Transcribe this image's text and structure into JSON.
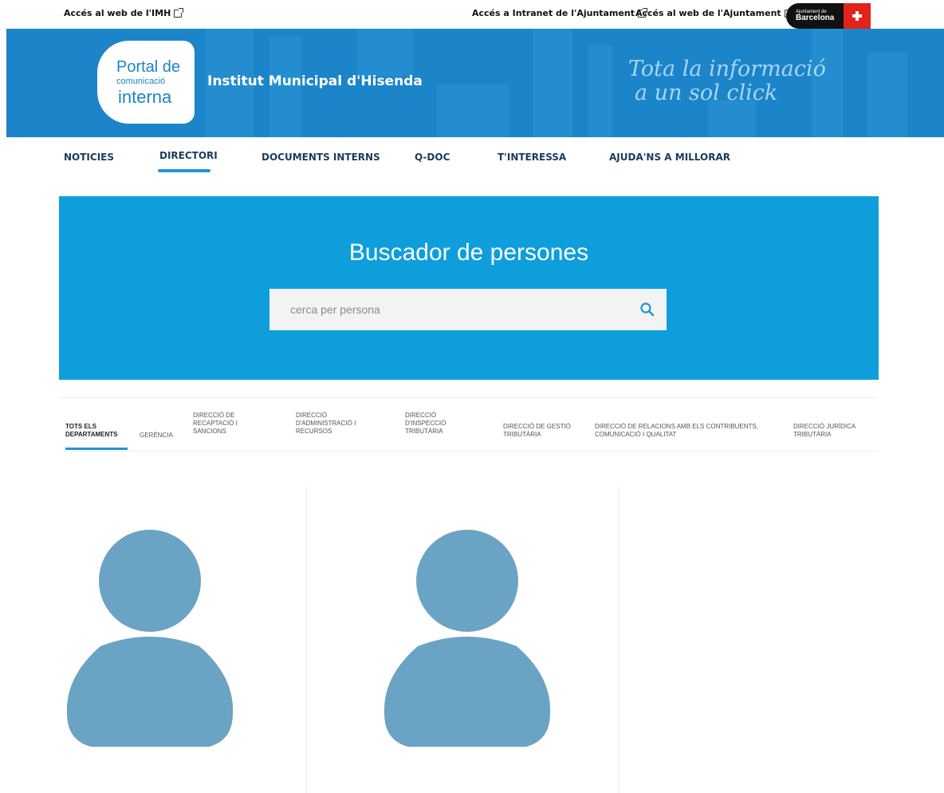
{
  "topbar": {
    "imh_link": "Accés al web de l'IMH",
    "intranet_link": "Accés a Intranet de l'Ajuntament",
    "ajuntament_link": "Accés al web de l'Ajuntament",
    "badge_small": "Ajuntament de",
    "badge_big": "Barcelona"
  },
  "header": {
    "logo_line1": "Portal de",
    "logo_line2": "comunicació",
    "logo_line3": "interna",
    "site_title": "Institut Municipal d'Hisenda",
    "tagline_line1": "Tota la informació",
    "tagline_line2": "a un sol click"
  },
  "nav": {
    "items": [
      {
        "label": "NOTICIES"
      },
      {
        "label": "DIRECTORI"
      },
      {
        "label": "DOCUMENTS INTERNS"
      },
      {
        "label": "Q-DOC"
      },
      {
        "label": "T'INTERESSA"
      },
      {
        "label": "AJUDA'NS A MILLORAR"
      }
    ],
    "active": "DIRECTORI"
  },
  "search": {
    "title": "Buscador de persones",
    "placeholder": "cerca per persona",
    "value": ""
  },
  "departments": {
    "items": [
      {
        "label": "TOTS ELS DEPARTAMENTS"
      },
      {
        "label": "GERÈNCIA"
      },
      {
        "label": "DIRECCIÓ DE RECAPTACIÓ I SANCIONS"
      },
      {
        "label": "DIRECCIÓ D'ADMINISTRACIÓ I RECURSOS"
      },
      {
        "label": "DIRECCIÓ D'INSPECCIÓ TRIBUTÀRIA"
      },
      {
        "label": "DIRECCIÓ DE GESTIÓ TRIBUTÀRIA"
      },
      {
        "label": "DIRECCIÓ DE RELACIONS AMB ELS CONTRIBUENTS, COMUNICACIÓ I QUALITAT"
      },
      {
        "label": "DIRECCIÓ JURÍDICA TRIBUTÀRIA"
      }
    ],
    "active": "TOTS ELS DEPARTAMENTS"
  },
  "colors": {
    "banner": "#1c84c9",
    "hero": "#0e9edc",
    "accent": "#2196d3",
    "avatar": "#6aa3c4",
    "barcelona_red": "#e2231a"
  },
  "icons": {
    "external": "external-link-icon",
    "search": "magnifier-icon",
    "avatar": "person-silhouette-icon"
  }
}
